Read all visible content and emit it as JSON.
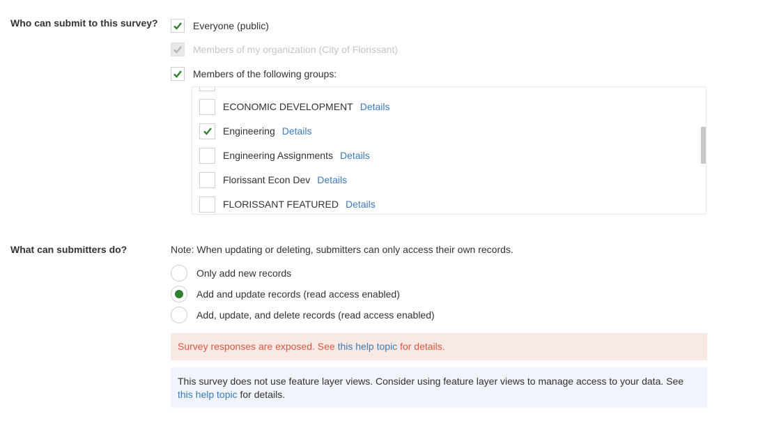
{
  "who_section": {
    "label": "Who can submit to this survey?",
    "options": [
      {
        "label": "Everyone (public)",
        "checked": true,
        "disabled": false
      },
      {
        "label": "Members of my organization (City of Florissant)",
        "checked": true,
        "disabled": true
      },
      {
        "label": "Members of the following groups:",
        "checked": true,
        "disabled": false
      }
    ],
    "groups": [
      {
        "name": "ECONOMIC DEVELOPMENT",
        "checked": false,
        "details": "Details"
      },
      {
        "name": "Engineering",
        "checked": true,
        "details": "Details"
      },
      {
        "name": "Engineering Assignments",
        "checked": false,
        "details": "Details"
      },
      {
        "name": "Florissant Econ Dev",
        "checked": false,
        "details": "Details"
      },
      {
        "name": "FLORISSANT FEATURED",
        "checked": false,
        "details": "Details"
      }
    ]
  },
  "what_section": {
    "label": "What can submitters do?",
    "note": "Note: When updating or deleting, submitters can only access their own records.",
    "options": [
      {
        "label": "Only add new records",
        "selected": false
      },
      {
        "label": "Add and update records (read access enabled)",
        "selected": true
      },
      {
        "label": "Add, update, and delete records (read access enabled)",
        "selected": false
      }
    ]
  },
  "alert_danger": {
    "text_before": "Survey responses are exposed. See ",
    "link": "this help topic",
    "text_after": " for details."
  },
  "alert_info": {
    "text_before": "This survey does not use feature layer views. Consider using feature layer views to manage access to your data. See ",
    "link": "this help topic",
    "text_after": " for details."
  },
  "colors": {
    "check": "#2f7f2f",
    "link": "#3a7bb8",
    "danger_text": "#d9583f",
    "danger_bg": "#f8e9e4",
    "info_bg": "#f1f4fa"
  }
}
